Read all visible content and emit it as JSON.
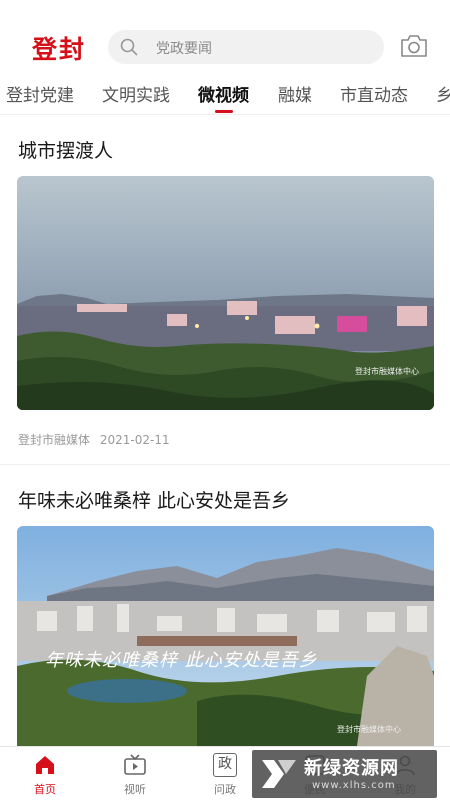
{
  "header": {
    "logo_text": "登封",
    "search_placeholder": "党政要闻"
  },
  "tabs": [
    {
      "label": "登封党建",
      "active": false
    },
    {
      "label": "文明实践",
      "active": false
    },
    {
      "label": "微视频",
      "active": true
    },
    {
      "label": "融媒",
      "active": false
    },
    {
      "label": "市直动态",
      "active": false
    },
    {
      "label": "乡",
      "active": false
    }
  ],
  "feed": [
    {
      "title": "城市摆渡人",
      "source": "登封市融媒体",
      "date": "2021-02-11",
      "image_caption": "登封市融媒体中心"
    },
    {
      "title": "年味未必唯桑梓  此心安处是吾乡",
      "image_overlay_text": "年味未必唯桑梓  此心安处是吾乡",
      "image_caption": "登封市融媒体中心"
    }
  ],
  "tabbar": [
    {
      "label": "首页",
      "icon": "home-icon",
      "active": true
    },
    {
      "label": "视听",
      "icon": "tv-icon",
      "active": false
    },
    {
      "label": "问政",
      "icon": "politics-icon",
      "icon_text": "政",
      "active": false
    },
    {
      "label": "便民",
      "icon": "service-icon",
      "active": false
    },
    {
      "label": "我的",
      "icon": "user-icon",
      "active": false
    }
  ],
  "watermark": {
    "main": "新绿资源网",
    "sub": "www.xlhs.com"
  },
  "colors": {
    "accent": "#d6101a",
    "text": "#1a1a1a",
    "muted": "#999999"
  }
}
